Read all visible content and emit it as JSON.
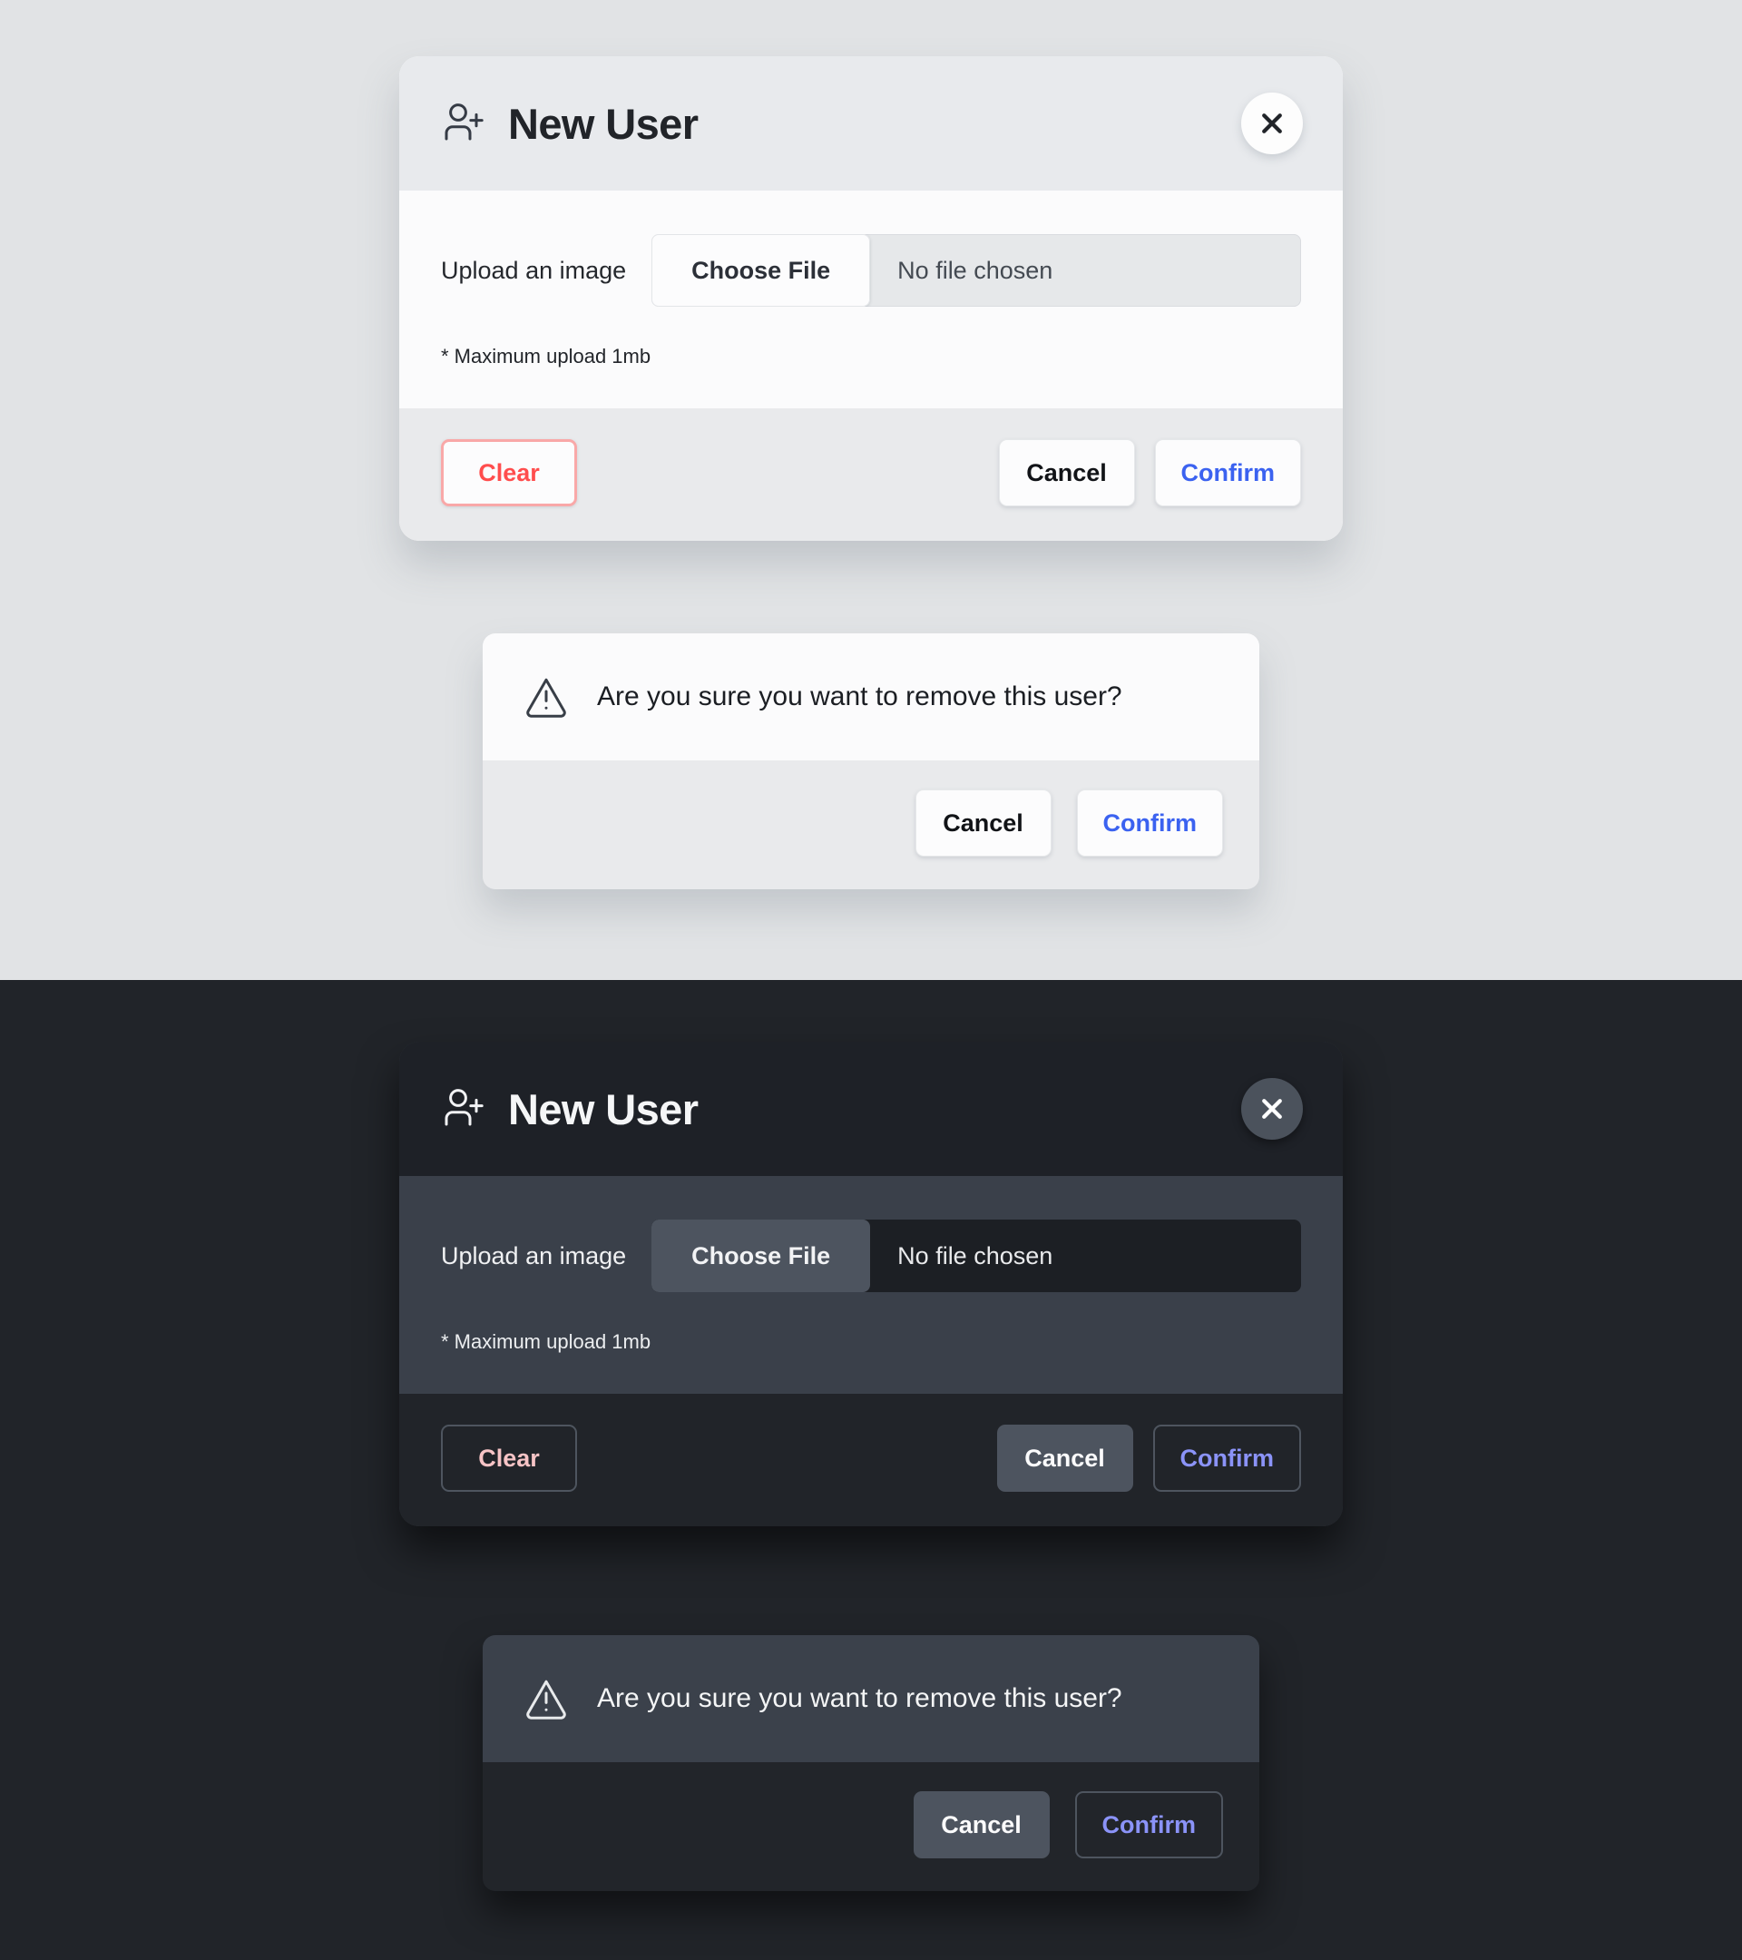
{
  "themes": {
    "light": {
      "name": "light-theme",
      "background_color": "#e1e3e5"
    },
    "dark": {
      "name": "dark-theme",
      "background_color": "#212429"
    }
  },
  "modal": {
    "title": "New User",
    "title_icon": "person-add-icon",
    "close_icon": "close-icon",
    "upload": {
      "label": "Upload an image",
      "choose_file_label": "Choose File",
      "file_name": "No file chosen",
      "note": "* Maximum upload 1mb"
    },
    "footer": {
      "clear_label": "Clear",
      "cancel_label": "Cancel",
      "confirm_label": "Confirm"
    }
  },
  "confirm_dialog": {
    "warning_icon": "warning-triangle-icon",
    "message": "Are you sure you want to remove this user?",
    "cancel_label": "Cancel",
    "confirm_label": "Confirm"
  },
  "colors": {
    "accent_blue_light": "#3b62f0",
    "accent_blue_dark": "#8b93f8",
    "danger_light": "#ff4d4d",
    "danger_dark": "#f7c4c6",
    "card_light": "#fbfbfc",
    "card_dark": "#3a404a",
    "header_light": "#e8eaed",
    "header_dark": "#1e2127"
  }
}
